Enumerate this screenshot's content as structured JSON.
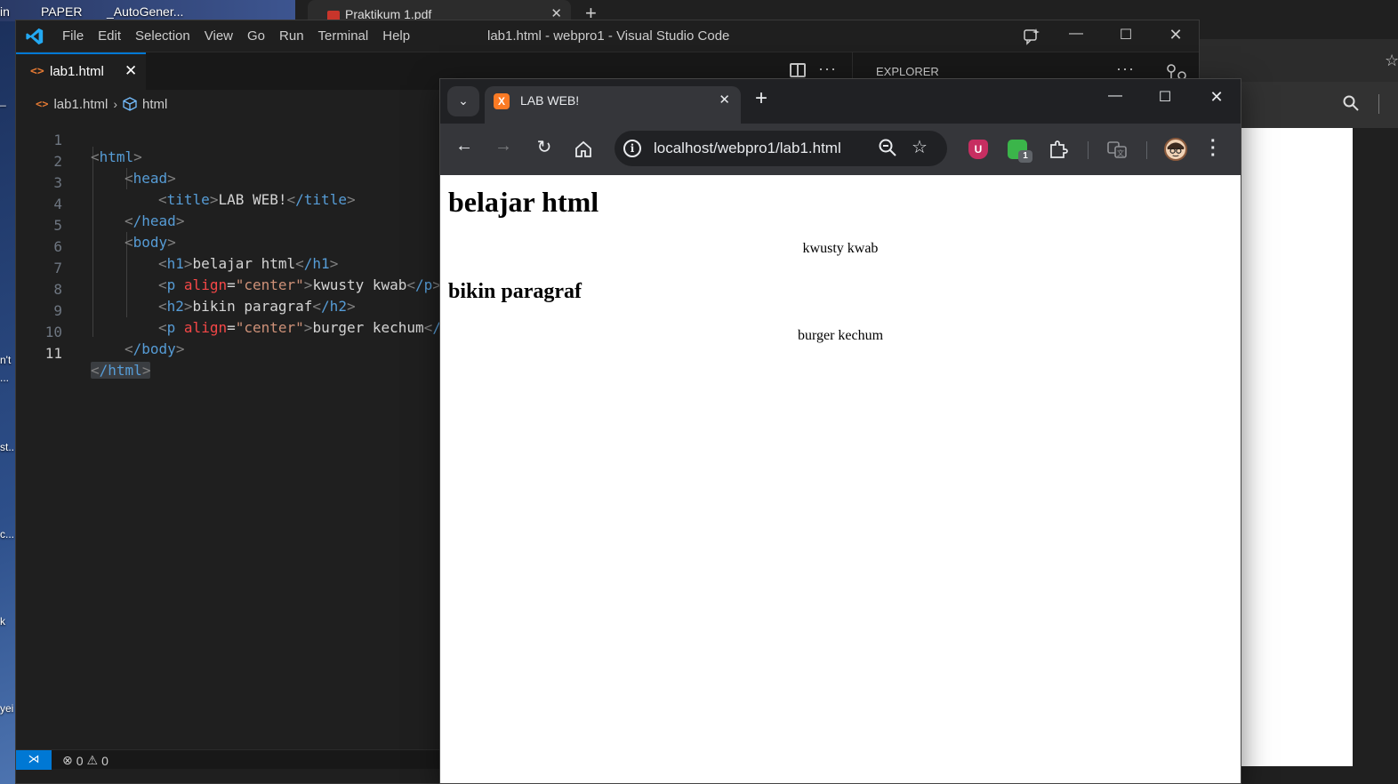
{
  "desktop": {
    "top_labels": [
      "in",
      "PAPER",
      "_AutoGener..."
    ],
    "side_labels": [
      "_",
      "n't",
      "...",
      "st..",
      "c...",
      "k",
      "yei"
    ]
  },
  "background_window": {
    "tab_title": "Praktikum 1.pdf"
  },
  "vscode": {
    "menu": [
      "File",
      "Edit",
      "Selection",
      "View",
      "Go",
      "Run",
      "Terminal",
      "Help"
    ],
    "window_title": "lab1.html - webpro1 - Visual Studio Code",
    "tab_label": "lab1.html",
    "explorer_label": "EXPLORER",
    "breadcrumb": {
      "file": "lab1.html",
      "symbol": "html"
    },
    "line_numbers": [
      "1",
      "2",
      "3",
      "4",
      "5",
      "6",
      "7",
      "8",
      "9",
      "10",
      "11"
    ],
    "code": {
      "l1_tag": "html",
      "l2_tag": "head",
      "l3_tag": "title",
      "l3_text": "LAB WEB!",
      "l3_close": "/title",
      "l4_tag": "/head",
      "l5_tag": "body",
      "l6_tag": "h1",
      "l6_text": "belajar html",
      "l6_close": "/h1",
      "l7_tag": "p",
      "l7_attr": "align",
      "l7_val": "\"center\"",
      "l7_text": "kwusty kwab",
      "l7_close": "/p",
      "l8_tag": "h2",
      "l8_text": "bikin paragraf",
      "l8_close": "/h2",
      "l9_tag": "p",
      "l9_attr": "align",
      "l9_val": "\"center\"",
      "l9_text": "burger kechum",
      "l9_close": "/",
      "l10_tag": "/body",
      "l11_tag": "/html"
    },
    "status": {
      "errors": "0",
      "warnings": "0"
    }
  },
  "chrome": {
    "tab_title": "LAB WEB!",
    "url": "localhost/webpro1/lab1.html",
    "extension_badge": "1",
    "ublock_letter": "U",
    "favicon_letter": "X"
  },
  "page": {
    "h1": "belajar html",
    "p1": "kwusty kwab",
    "h2": "bikin paragraf",
    "p2": "burger kechum"
  },
  "colors": {
    "accent": "#0078d4",
    "editor_bg": "#1f1f1f",
    "chrome_frame": "#202124",
    "chrome_toolbar": "#35363a",
    "tag_blue": "#569cd6",
    "attr_red": "#f44747",
    "string_orange": "#ce9178"
  }
}
